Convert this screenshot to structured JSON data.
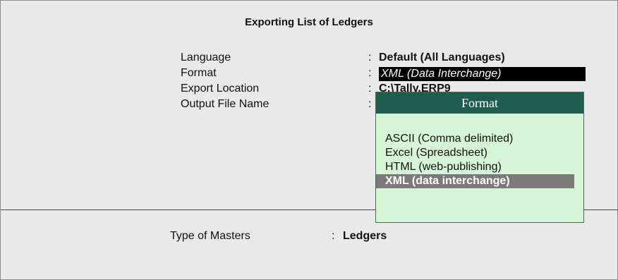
{
  "screen": {
    "title": "Exporting  List of Ledgers"
  },
  "fields": [
    {
      "label": "Language",
      "value": "Default (All Languages)"
    },
    {
      "label": "Format",
      "value": "XML (Data Interchange)"
    },
    {
      "label": "Export Location",
      "value": "C:\\Tally.ERP9"
    },
    {
      "label": "Output File Name",
      "value": ""
    }
  ],
  "masters": {
    "label": "Type of Masters",
    "value": "Ledgers"
  },
  "format_popup": {
    "title": "Format",
    "options": [
      "ASCII (Comma delimited)",
      "Excel (Spreadsheet)",
      "HTML (web-publishing)",
      "XML (data interchange)"
    ],
    "selected_index": 3
  },
  "colors": {
    "background": "#e9e9e9",
    "popup_bg": "#d6f5d6",
    "popup_header": "#1f5e4e",
    "highlight": "#7a7a7a"
  }
}
